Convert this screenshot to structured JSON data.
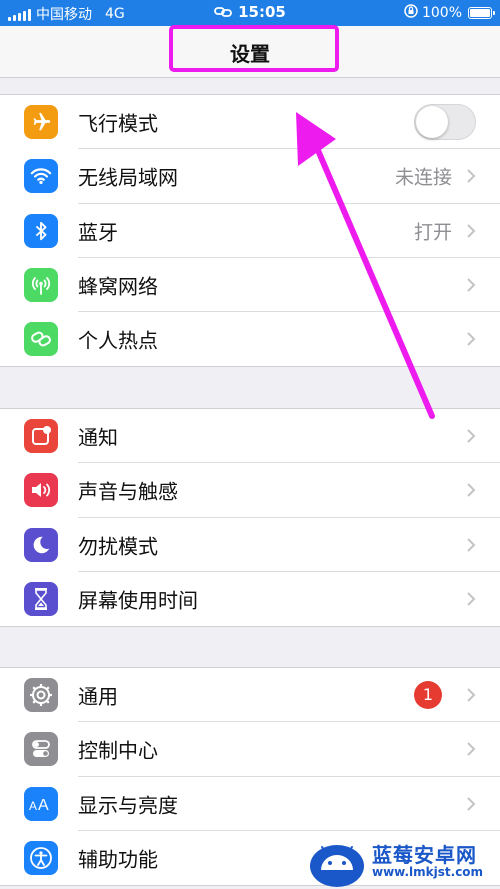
{
  "status_bar": {
    "carrier": "中国移动",
    "network": "4G",
    "time": "15:05",
    "battery": "100%"
  },
  "nav": {
    "title": "设置"
  },
  "groups": [
    {
      "items": [
        {
          "label": "飞行模式",
          "icon": "airplane-icon",
          "color": "#f39c12",
          "toggle": "off"
        },
        {
          "label": "无线局域网",
          "value": "未连接",
          "icon": "wifi-icon",
          "color": "#1a82fb"
        },
        {
          "label": "蓝牙",
          "value": "打开",
          "icon": "bluetooth-icon",
          "color": "#1a82fb"
        },
        {
          "label": "蜂窝网络",
          "icon": "antenna-icon",
          "color": "#4cd964"
        },
        {
          "label": "个人热点",
          "icon": "hotspot-link-icon",
          "color": "#4cd964"
        }
      ]
    },
    {
      "items": [
        {
          "label": "通知",
          "icon": "notification-icon",
          "color": "#e9453a"
        },
        {
          "label": "声音与触感",
          "icon": "speaker-icon",
          "color": "#e9384f"
        },
        {
          "label": "勿扰模式",
          "icon": "moon-icon",
          "color": "#5a4fcf"
        },
        {
          "label": "屏幕使用时间",
          "icon": "hourglass-icon",
          "color": "#5a4fcf"
        }
      ]
    },
    {
      "items": [
        {
          "label": "通用",
          "badge": "1",
          "icon": "gear-icon",
          "color": "#8e8e93"
        },
        {
          "label": "控制中心",
          "icon": "switches-icon",
          "color": "#8e8e93"
        },
        {
          "label": "显示与亮度",
          "icon": "text-size-icon",
          "color": "#1a82fb"
        },
        {
          "label": "辅助功能",
          "icon": "accessibility-icon",
          "color": "#1a82fb"
        }
      ]
    }
  ],
  "watermark": {
    "title": "蓝莓安卓网",
    "url": "www.lmkjst.com"
  },
  "annotation_color": "#ee1bee"
}
